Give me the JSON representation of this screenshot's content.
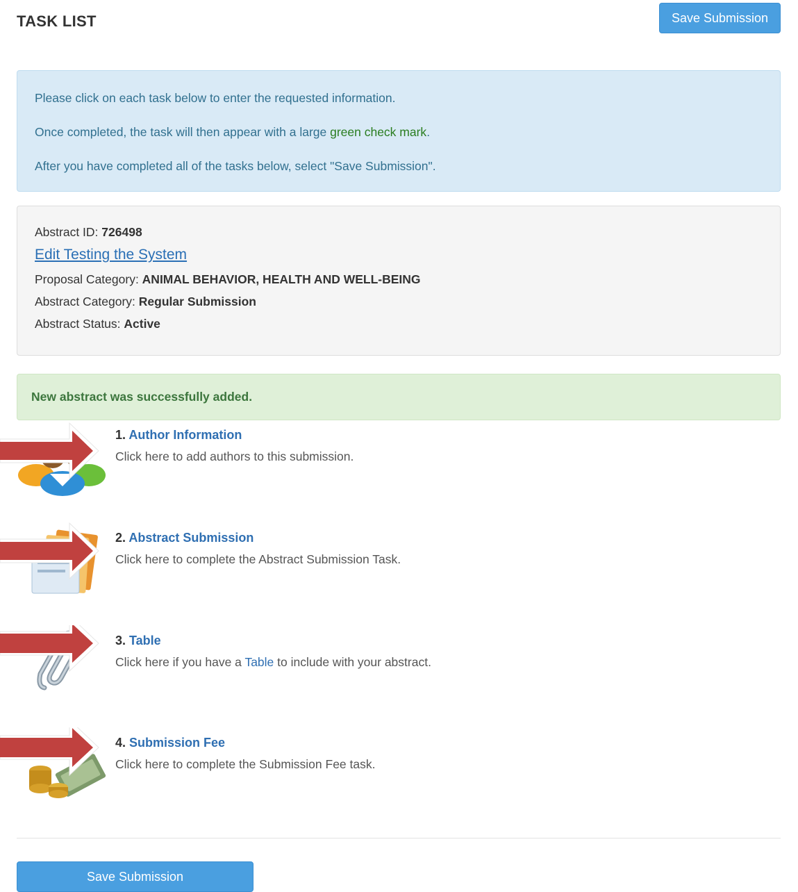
{
  "header": {
    "title": "TASK LIST",
    "save_label": "Save Submission"
  },
  "instructions": {
    "line1": "Please click on each task below to enter the requested information.",
    "line2_pre": "Once completed, the task will then appear with a large ",
    "line2_green": "green check mark",
    "line2_post": ".",
    "line3": "After you have completed all of the tasks below, select \"Save Submission\"."
  },
  "abstract": {
    "id_label": "Abstract ID: ",
    "id_value": "726498",
    "edit_link": "Edit Testing the System",
    "proposal_label": "Proposal Category: ",
    "proposal_value": "ANIMAL BEHAVIOR, HEALTH AND WELL-BEING",
    "category_label": "Abstract Category: ",
    "category_value": "Regular Submission",
    "status_label": "Abstract Status: ",
    "status_value": "Active"
  },
  "alert": {
    "message": "New abstract was successfully added."
  },
  "tasks": [
    {
      "number": "1. ",
      "title": "Author Information",
      "desc": "Click here to add authors to this submission.",
      "icon": "authors-group-icon"
    },
    {
      "number": "2. ",
      "title": "Abstract Submission",
      "desc": "Click here to complete the Abstract Submission Task.",
      "icon": "documents-icon"
    },
    {
      "number": "3. ",
      "title": "Table",
      "desc_pre": "Click here if you have a ",
      "desc_link": "Table",
      "desc_post": " to include with your abstract.",
      "icon": "paperclip-icon"
    },
    {
      "number": "4. ",
      "title": "Submission Fee",
      "desc": "Click here to complete the Submission Fee task.",
      "icon": "money-coins-icon"
    }
  ],
  "footer": {
    "save_label": "Save Submission"
  },
  "colors": {
    "primary_button": "#4a9fe0",
    "link": "#2f6fb2",
    "arrow": "#c0413f",
    "info_bg": "#d9eaf6",
    "success_bg": "#dff0d8"
  }
}
